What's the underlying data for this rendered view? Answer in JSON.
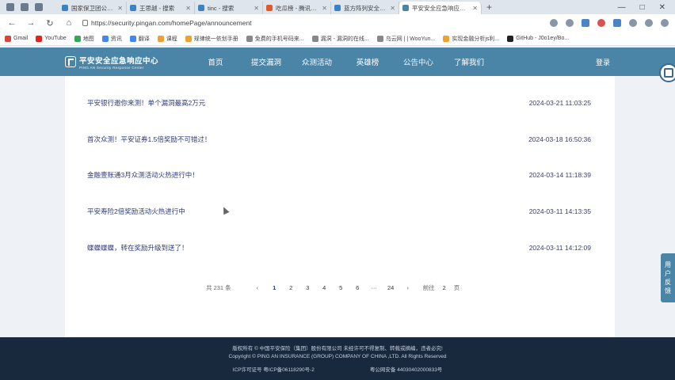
{
  "browser": {
    "tabs": [
      {
        "label": "国家保卫团公-搜索",
        "color": "#3b82c4"
      },
      {
        "label": "王思越 - 搜索",
        "color": "#3b82c4"
      },
      {
        "label": "tinc - 搜索",
        "color": "#3b82c4"
      },
      {
        "label": "吃瓜榜 - 腾讯安全应急响",
        "color": "#e05a2a"
      },
      {
        "label": "蓝方阵列安全评估中心",
        "color": "#3b82c4"
      },
      {
        "label": "平安安全应急响应中心",
        "color": "#4a85a8",
        "active": true
      }
    ],
    "new_tab": "+",
    "window_controls": [
      "—",
      "□",
      "✕"
    ],
    "nav": {
      "back": "←",
      "forward": "→",
      "reload": "↻",
      "home": "⌂"
    },
    "url": "https://security.pingan.com/homePage/announcement"
  },
  "bookmarks": [
    "Gmail",
    "YouTube",
    "地图",
    "资讯",
    "翻译",
    "课程",
    "规律统一依划手册",
    "免费的手机号码来...",
    "漏洞 - 漏洞的在线...",
    "乌云网 | | WooYun...",
    "实现金融分析js利...",
    "GitHub - J0o1ey/Bo..."
  ],
  "site": {
    "logo_title": "平安安全应急响应中心",
    "logo_sub": "PING AN Security Response Center",
    "nav": [
      "首页",
      "提交漏洞",
      "众测活动",
      "英雄榜",
      "公告中心",
      "了解我们"
    ],
    "login": "登录"
  },
  "announcements": [
    {
      "title": "平安银行邀你来测！单个漏洞最高2万元",
      "date": "2024-03-21 11:03:25"
    },
    {
      "title": "首次众测！平安证券1.5倍奖励不可错过！",
      "date": "2024-03-18 16:50:36"
    },
    {
      "title": "金融壹账通3月众测活动火热进行中！",
      "date": "2024-03-14 11:18:39"
    },
    {
      "title": "平安寿险2倍奖励活动火热进行中",
      "date": "2024-03-11 14:13:35"
    },
    {
      "title": "蝶蝶蝶蝶，转在奖励升级到送了！",
      "date": "2024-03-11 14:12:09"
    }
  ],
  "pagination": {
    "total": "共 231 条",
    "prev": "‹",
    "pages": [
      "1",
      "2",
      "3",
      "4",
      "5",
      "6",
      "···",
      "24"
    ],
    "current": "1",
    "next": "›",
    "goto_label": "前往",
    "goto_value": "2",
    "unit": "页"
  },
  "float_tab": [
    "用",
    "户",
    "反",
    "馈"
  ],
  "footer": {
    "line1": "版权所有 © 中国平安保险（集团）股份有限公司 未经许可不得复制、转载或摘编，违者必究!",
    "line2": "Copyright © PING AN INSURANCE (GROUP) COMPANY OF CHINA ,LTD. All Rights Reserved",
    "icp": "ICP许可证号 粤ICP备06118290号-2",
    "police": "粤公网安备 44030402000833号"
  }
}
